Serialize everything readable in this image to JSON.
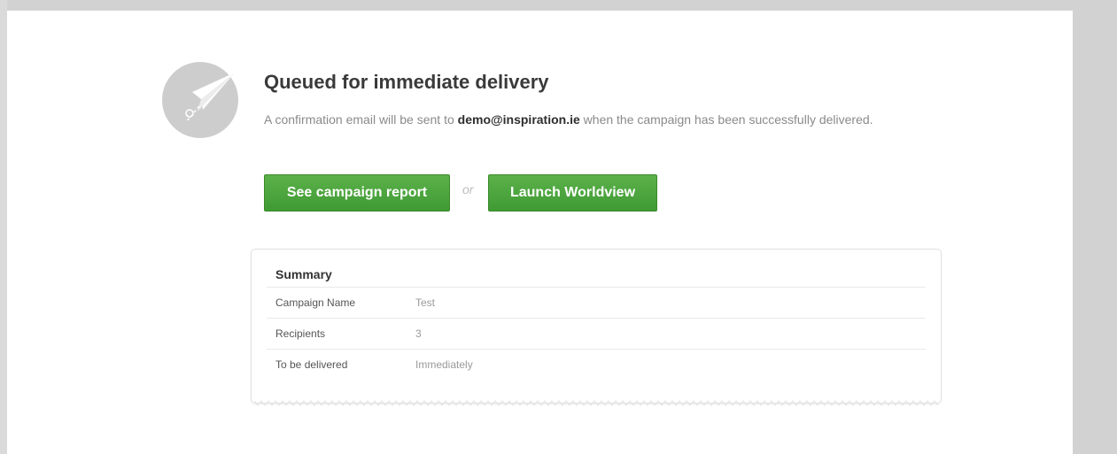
{
  "confirmation": {
    "title": "Queued for immediate delivery",
    "message_before": "A confirmation email will be sent to ",
    "email": "demo@inspiration.ie",
    "message_after": " when the campaign has been successfully delivered."
  },
  "actions": {
    "report_button": "See campaign report",
    "separator": "or",
    "worldview_button": "Launch Worldview"
  },
  "summary": {
    "title": "Summary",
    "rows": [
      {
        "label": "Campaign Name",
        "value": "Test"
      },
      {
        "label": "Recipients",
        "value": "3"
      },
      {
        "label": "To be delivered",
        "value": "Immediately"
      }
    ]
  },
  "icons": {
    "status_icon": "paper-plane-icon"
  },
  "colors": {
    "button_green": "#4ea93e",
    "page_background": "#d2d2d2",
    "panel_background": "#ffffff"
  }
}
